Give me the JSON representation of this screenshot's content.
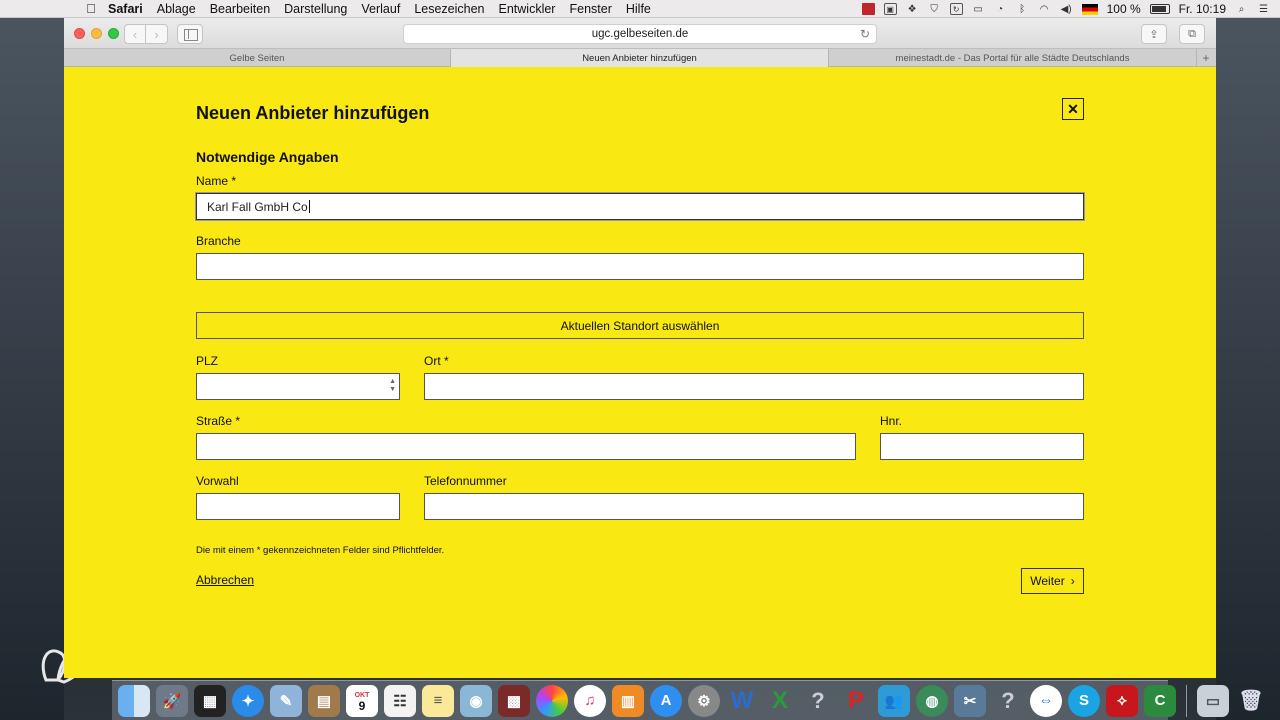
{
  "menubar": {
    "app_name": "Safari",
    "items": [
      "Ablage",
      "Bearbeiten",
      "Darstellung",
      "Verlauf",
      "Lesezeichen",
      "Entwickler",
      "Fenster",
      "Hilfe"
    ],
    "battery": "100 %",
    "clock": "Fr. 10:19"
  },
  "browser": {
    "url": "ugc.gelbeseiten.de",
    "tabs": [
      {
        "label": "Gelbe Seiten"
      },
      {
        "label": "Neuen Anbieter hinzufügen"
      },
      {
        "label": "meinestadt.de - Das Portal für alle Städte Deutschlands"
      }
    ]
  },
  "form": {
    "title": "Neuen Anbieter hinzufügen",
    "section_title": "Notwendige Angaben",
    "name_label": "Name *",
    "name_value": "Karl Fall GmbH Co",
    "branche_label": "Branche",
    "location_button": "Aktuellen Standort auswählen",
    "plz_label": "PLZ",
    "ort_label": "Ort *",
    "strasse_label": "Straße *",
    "hnr_label": "Hnr.",
    "vorwahl_label": "Vorwahl",
    "telefon_label": "Telefonnummer",
    "required_note": "Die mit einem * gekennzeichneten Felder sind Pflichtfelder.",
    "cancel_label": "Abbrechen",
    "next_label": "Weiter"
  },
  "dock": {
    "calendar_month": "OKT",
    "calendar_day": "9",
    "word_letter": "W",
    "excel_letter": "X",
    "powerpoint_letter": "P",
    "skype_letter": "S"
  }
}
